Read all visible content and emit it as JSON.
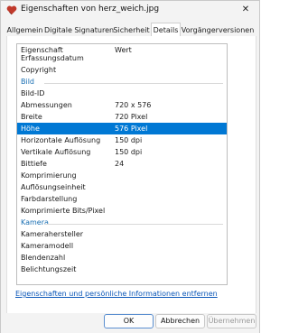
{
  "window": {
    "title": "Eigenschaften von herz_weich.jpg",
    "close_glyph": "✕",
    "app_icon": "heart-file-icon"
  },
  "tabs": [
    {
      "label": "Allgemein"
    },
    {
      "label": "Digitale Signaturen"
    },
    {
      "label": "Sicherheit"
    },
    {
      "label": "Details"
    },
    {
      "label": "Vorgängerversionen"
    }
  ],
  "active_tab": "Details",
  "table": {
    "header": {
      "name": "Eigenschaft",
      "name_cut": "Erfassungsdatum",
      "value": "Wert"
    },
    "rows": [
      {
        "type": "item",
        "key": "Copyright",
        "value": ""
      },
      {
        "type": "section",
        "label": "Bild"
      },
      {
        "type": "item",
        "key": "Bild-ID",
        "value": ""
      },
      {
        "type": "item",
        "key": "Abmessungen",
        "value": "720 x 576"
      },
      {
        "type": "item",
        "key": "Breite",
        "value": "720 Pixel"
      },
      {
        "type": "item",
        "key": "Höhe",
        "value": "576 Pixel",
        "selected": true
      },
      {
        "type": "item",
        "key": "Horizontale Auflösung",
        "value": "150 dpi"
      },
      {
        "type": "item",
        "key": "Vertikale Auflösung",
        "value": "150 dpi"
      },
      {
        "type": "item",
        "key": "Bittiefe",
        "value": "24"
      },
      {
        "type": "item",
        "key": "Komprimierung",
        "value": ""
      },
      {
        "type": "item",
        "key": "Auflösungseinheit",
        "value": ""
      },
      {
        "type": "item",
        "key": "Farbdarstellung",
        "value": ""
      },
      {
        "type": "item",
        "key": "Komprimierte Bits/Pixel",
        "value": ""
      },
      {
        "type": "section",
        "label": "Kamera"
      },
      {
        "type": "item",
        "key": "Kamerahersteller",
        "value": ""
      },
      {
        "type": "item",
        "key": "Kameramodell",
        "value": ""
      },
      {
        "type": "item",
        "key": "Blendenzahl",
        "value": ""
      },
      {
        "type": "item",
        "key": "Belichtungszeit",
        "value": ""
      }
    ]
  },
  "remove_link": "Eigenschaften und persönliche Informationen entfernen",
  "buttons": {
    "ok": "OK",
    "cancel": "Abbrechen",
    "apply": "Übernehmen"
  },
  "colors": {
    "selection": "#0078d4",
    "section": "#1a6fb3",
    "link": "#0b57b8"
  }
}
